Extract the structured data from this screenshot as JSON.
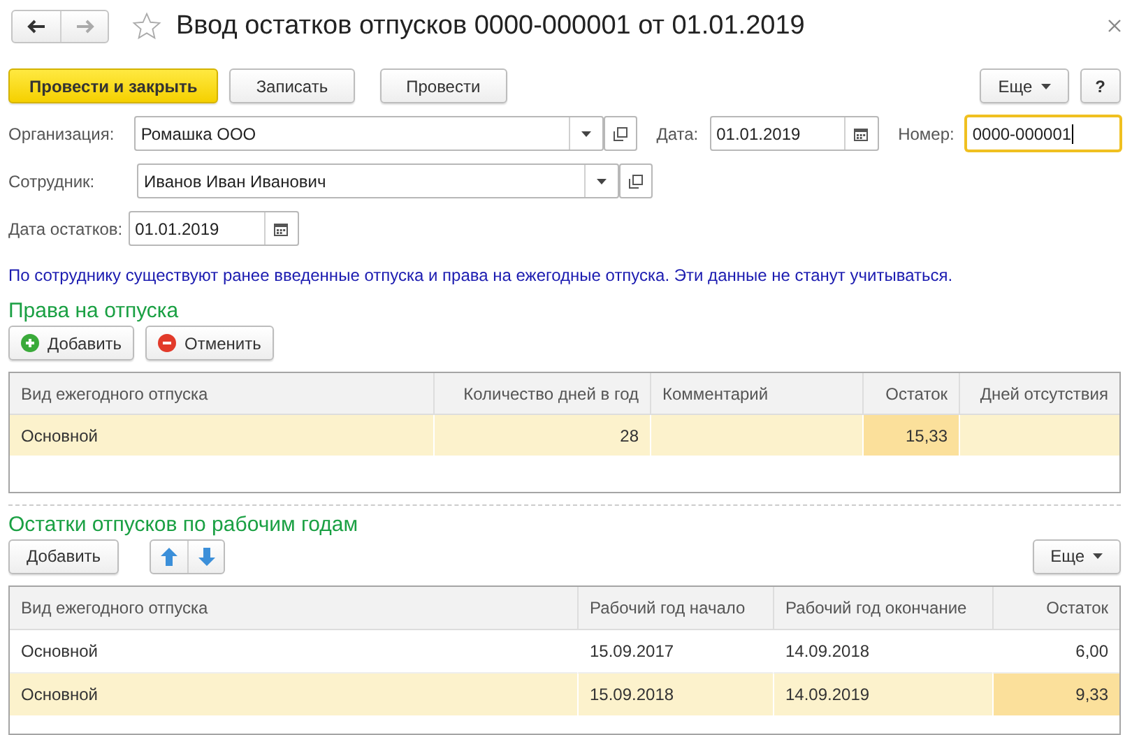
{
  "window": {
    "title": "Ввод остатков отпусков 0000-000001 от 01.01.2019",
    "favorite": false
  },
  "toolbar": {
    "buttons": [
      {
        "label": "Провести и закрыть",
        "kind": "primary"
      },
      {
        "label": "Записать",
        "kind": "normal"
      },
      {
        "label": "Провести",
        "kind": "normal"
      }
    ],
    "more": "Еще",
    "help": "?"
  },
  "fields": {
    "organization": {
      "label": "Организация:",
      "value": "Ромашка ООО"
    },
    "date": {
      "label": "Дата:",
      "value": "01.01.2019"
    },
    "number": {
      "label": "Номер:",
      "value": "0000-000001",
      "focused": true
    },
    "employee": {
      "label": "Сотрудник:",
      "value": "Иванов Иван Иванович"
    },
    "balance_date": {
      "label": "Дата остатков:",
      "value": "01.01.2019"
    }
  },
  "notice": "По сотруднику существуют ранее введенные отпуска и права на ежегодные отпуска. Эти данные не станут учитываться.",
  "rights": {
    "title": "Права на отпуска",
    "buttons": [
      {
        "label": "Добавить",
        "kind": "add"
      },
      {
        "label": "Отменить",
        "kind": "cancel"
      }
    ],
    "columns": [
      {
        "label": "Вид ежегодного отпуска",
        "kind": "text"
      },
      {
        "label": "Количество дней в год",
        "kind": "number"
      },
      {
        "label": "Комментарий",
        "kind": "text"
      },
      {
        "label": "Остаток",
        "kind": "number"
      },
      {
        "label": "Дней отсутствия",
        "kind": "number"
      }
    ],
    "rows": [
      {
        "selected": true,
        "cells": [
          {
            "text": "Основной",
            "current": false
          },
          {
            "text": "28",
            "current": false
          },
          {
            "text": "",
            "current": false
          },
          {
            "text": "15,33",
            "current": true
          },
          {
            "text": "",
            "current": false
          }
        ]
      }
    ]
  },
  "balances": {
    "title": "Остатки отпусков по рабочим годам",
    "add": "Добавить",
    "more": "Еще",
    "columns": [
      {
        "label": "Вид ежегодного отпуска",
        "kind": "text"
      },
      {
        "label": "Рабочий год начало",
        "kind": "date"
      },
      {
        "label": "Рабочий год окончание",
        "kind": "date"
      },
      {
        "label": "Остаток",
        "kind": "number"
      }
    ],
    "rows": [
      {
        "selected": false,
        "cells": [
          {
            "text": "Основной",
            "current": false
          },
          {
            "text": "15.09.2017",
            "current": false
          },
          {
            "text": "14.09.2018",
            "current": false
          },
          {
            "text": "6,00",
            "current": false
          }
        ]
      },
      {
        "selected": true,
        "cells": [
          {
            "text": "Основной",
            "current": false
          },
          {
            "text": "15.09.2018",
            "current": false
          },
          {
            "text": "14.09.2019",
            "current": false
          },
          {
            "text": "9,33",
            "current": true
          }
        ]
      }
    ]
  }
}
